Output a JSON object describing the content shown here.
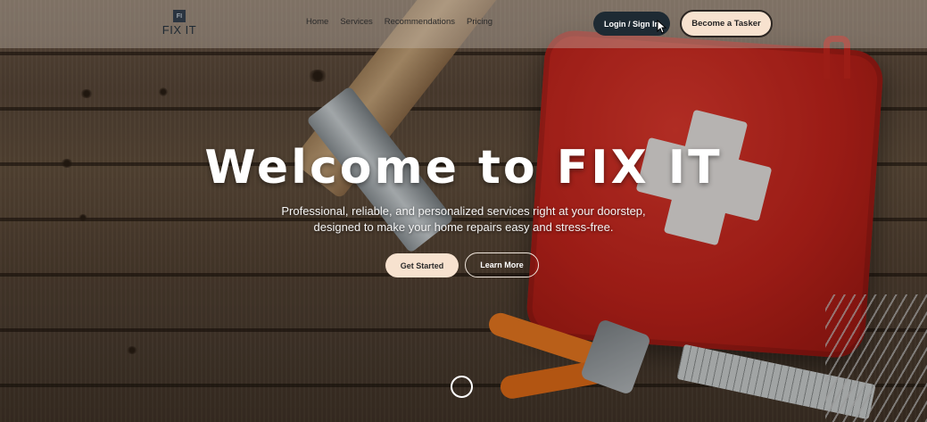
{
  "brand": {
    "mark": "FI",
    "name": "FIX IT"
  },
  "nav": {
    "links": [
      "Home",
      "Services",
      "Recommendations",
      "Pricing"
    ],
    "login_label": "Login / Sign In",
    "tasker_label": "Become a Tasker"
  },
  "hero": {
    "title": "Welcome to FIX IT",
    "subtitle_line1": "Professional, reliable, and personalized services right at your doorstep,",
    "subtitle_line2": "designed to make your home repairs easy and stress-free.",
    "primary_cta": "Get Started",
    "secondary_cta": "Learn More"
  },
  "colors": {
    "login_bg": "#1e2a33",
    "cta_bg": "#f7e2cf",
    "hero_text": "#ffffff"
  }
}
